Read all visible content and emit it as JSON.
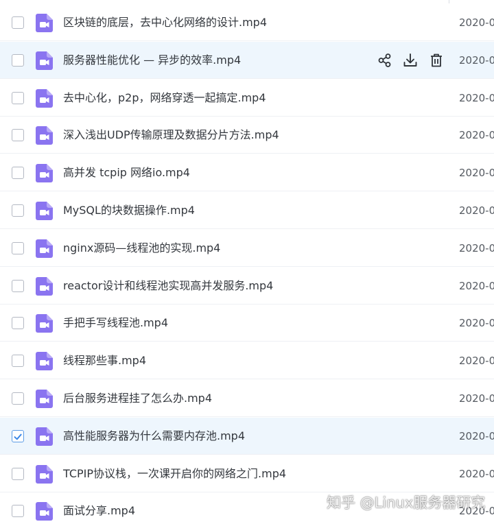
{
  "files": [
    {
      "name": "区块链的底层，去中心化网络的设计.mp4",
      "date": "2020-0",
      "checked": false
    },
    {
      "name": "服务器性能优化 — 异步的效率.mp4",
      "date": "2020-0",
      "checked": false,
      "hover_actions": true
    },
    {
      "name": "去中心化，p2p，网络穿透一起搞定.mp4",
      "date": "2020-0",
      "checked": false
    },
    {
      "name": "深入浅出UDP传输原理及数据分片方法.mp4",
      "date": "2020-0",
      "checked": false
    },
    {
      "name": "高并发 tcpip 网络io.mp4",
      "date": "2020-0",
      "checked": false
    },
    {
      "name": "MySQL的块数据操作.mp4",
      "date": "2020-0",
      "checked": false
    },
    {
      "name": "nginx源码—线程池的实现.mp4",
      "date": "2020-0",
      "checked": false
    },
    {
      "name": "reactor设计和线程池实现高并发服务.mp4",
      "date": "2020-0",
      "checked": false
    },
    {
      "name": "手把手写线程池.mp4",
      "date": "2020-0",
      "checked": false
    },
    {
      "name": "线程那些事.mp4",
      "date": "2020-0",
      "checked": false
    },
    {
      "name": "后台服务进程挂了怎么办.mp4",
      "date": "2020-0",
      "checked": false
    },
    {
      "name": "高性能服务器为什么需要内存池.mp4",
      "date": "2020-0",
      "checked": true
    },
    {
      "name": "TCPIP协议栈，一次课开启你的网络之门.mp4",
      "date": "2020-0",
      "checked": false
    },
    {
      "name": "面试分享.mp4",
      "date": "2020-0",
      "checked": false
    }
  ],
  "row_actions": [
    "share-icon",
    "download-icon",
    "delete-icon"
  ],
  "watermark": "知乎 @Linux服务器研究",
  "colors": {
    "video_icon": "#8a74f0",
    "highlight_row": "#eef6fd",
    "checkbox_checked": "#3b87e6",
    "action_icon": "#2f3338"
  }
}
